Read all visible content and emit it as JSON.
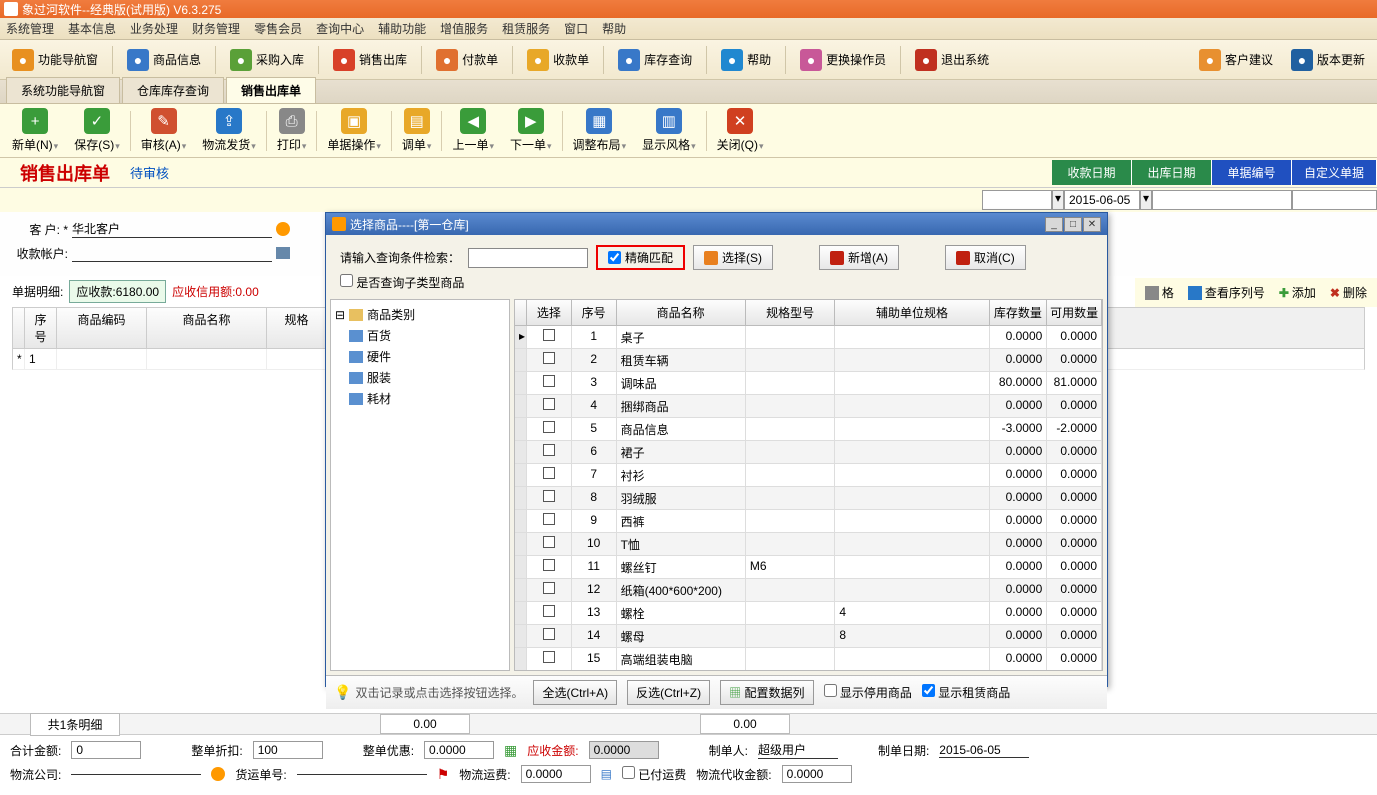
{
  "titlebar": "象过河软件--经典版(试用版)  V6.3.275",
  "menus": [
    "系统管理",
    "基本信息",
    "业务处理",
    "财务管理",
    "零售会员",
    "查询中心",
    "辅助功能",
    "增值服务",
    "租赁服务",
    "窗口",
    "帮助"
  ],
  "toolbar": [
    {
      "label": "功能导航窗",
      "color": "#e89020"
    },
    {
      "label": "商品信息",
      "color": "#3878c8"
    },
    {
      "label": "采购入库",
      "color": "#5aa038"
    },
    {
      "label": "销售出库",
      "color": "#d84028"
    },
    {
      "label": "付款单",
      "color": "#e07030"
    },
    {
      "label": "收款单",
      "color": "#e8a828"
    },
    {
      "label": "库存查询",
      "color": "#3878c8"
    },
    {
      "label": "帮助",
      "color": "#2088d0"
    },
    {
      "label": "更换操作员",
      "color": "#c85898"
    },
    {
      "label": "退出系统",
      "color": "#c03020"
    }
  ],
  "toolbar_right": [
    {
      "label": "客户建议",
      "color": "#e89030"
    },
    {
      "label": "版本更新",
      "color": "#2060a0"
    }
  ],
  "tabs": [
    "系统功能导航窗",
    "仓库库存查询",
    "销售出库单"
  ],
  "active_tab": 2,
  "doc_buttons": [
    {
      "label": "新单(N)",
      "color": "#3a9c3a",
      "glyph": "+"
    },
    {
      "label": "保存(S)",
      "color": "#3a9c3a",
      "glyph": "✓"
    },
    {
      "label": "审核(A)",
      "color": "#d05030",
      "glyph": "✎"
    },
    {
      "label": "物流发货",
      "color": "#2878c8",
      "glyph": "⇪"
    },
    {
      "label": "打印",
      "color": "#888",
      "glyph": "⎙"
    },
    {
      "label": "单据操作",
      "color": "#e8a828",
      "glyph": "▣"
    },
    {
      "label": "调单",
      "color": "#e8a828",
      "glyph": "▤"
    },
    {
      "label": "上一单",
      "color": "#3a9c3a",
      "glyph": "◀"
    },
    {
      "label": "下一单",
      "color": "#3a9c3a",
      "glyph": "▶"
    },
    {
      "label": "调整布局",
      "color": "#3878c8",
      "glyph": "▦"
    },
    {
      "label": "显示风格",
      "color": "#3878c8",
      "glyph": "▥"
    },
    {
      "label": "关闭(Q)",
      "color": "#d04020",
      "glyph": "✕"
    }
  ],
  "header": {
    "title": "销售出库单",
    "status": "待审核"
  },
  "header_buttons": [
    {
      "label": "收款日期",
      "bg": "#2a8a4a"
    },
    {
      "label": "出库日期",
      "bg": "#2a8a4a"
    },
    {
      "label": "单据编号",
      "bg": "#2050c0"
    },
    {
      "label": "自定义单据",
      "bg": "#2050c0"
    }
  ],
  "header_values": {
    "date": "2015-06-05"
  },
  "form": {
    "customer_label": "客    户: *",
    "customer": "华北客户",
    "account_label": "收款帐户:",
    "detail_label": "单据明细:",
    "receivable_label": "应收款:",
    "receivable": "6180.00",
    "credit_label": "应收信用额:",
    "credit": "0.00"
  },
  "grid_cols": [
    "序号",
    "商品编码",
    "商品名称",
    "规格"
  ],
  "grid_first": "1",
  "right_tools": [
    {
      "label": "格",
      "color": "#888"
    },
    {
      "label": "查看序列号",
      "color": "#2878c8"
    },
    {
      "label": "添加",
      "color": "#3a9c3a",
      "glyph": "✚"
    },
    {
      "label": "删除",
      "color": "#c03020",
      "glyph": "✖"
    }
  ],
  "modal": {
    "title": "选择商品----[第一仓库]",
    "search_label": "请输入查询条件检索：",
    "exact_label": "精确匹配",
    "sub_check": "是否查询子类型商品",
    "btn_select": "选择(S)",
    "btn_add": "新增(A)",
    "btn_cancel": "取消(C)",
    "tree_root": "商品类别",
    "tree_items": [
      "百货",
      "硬件",
      "服装",
      "耗材"
    ],
    "cols": [
      "选择",
      "序号",
      "商品名称",
      "规格型号",
      "辅助单位规格",
      "库存数量",
      "可用数量"
    ],
    "rows": [
      {
        "i": 1,
        "name": "桌子",
        "spec": "",
        "aux": "",
        "stock": "0.0000",
        "avail": "0.0000"
      },
      {
        "i": 2,
        "name": "租赁车辆",
        "spec": "",
        "aux": "",
        "stock": "0.0000",
        "avail": "0.0000"
      },
      {
        "i": 3,
        "name": "调味品",
        "spec": "",
        "aux": "",
        "stock": "80.0000",
        "avail": "81.0000"
      },
      {
        "i": 4,
        "name": "捆绑商品",
        "spec": "",
        "aux": "",
        "stock": "0.0000",
        "avail": "0.0000"
      },
      {
        "i": 5,
        "name": "商品信息",
        "spec": "",
        "aux": "",
        "stock": "-3.0000",
        "avail": "-2.0000"
      },
      {
        "i": 6,
        "name": "裙子",
        "spec": "",
        "aux": "",
        "stock": "0.0000",
        "avail": "0.0000"
      },
      {
        "i": 7,
        "name": "衬衫",
        "spec": "",
        "aux": "",
        "stock": "0.0000",
        "avail": "0.0000"
      },
      {
        "i": 8,
        "name": "羽绒服",
        "spec": "",
        "aux": "",
        "stock": "0.0000",
        "avail": "0.0000"
      },
      {
        "i": 9,
        "name": "西裤",
        "spec": "",
        "aux": "",
        "stock": "0.0000",
        "avail": "0.0000"
      },
      {
        "i": 10,
        "name": "T恤",
        "spec": "",
        "aux": "",
        "stock": "0.0000",
        "avail": "0.0000"
      },
      {
        "i": 11,
        "name": "螺丝钉",
        "spec": "M6",
        "aux": "",
        "stock": "0.0000",
        "avail": "0.0000"
      },
      {
        "i": 12,
        "name": "纸箱(400*600*200)",
        "spec": "",
        "aux": "",
        "stock": "0.0000",
        "avail": "0.0000"
      },
      {
        "i": 13,
        "name": "螺栓",
        "spec": "",
        "aux": "4",
        "stock": "0.0000",
        "avail": "0.0000"
      },
      {
        "i": 14,
        "name": "螺母",
        "spec": "",
        "aux": "8",
        "stock": "0.0000",
        "avail": "0.0000"
      },
      {
        "i": 15,
        "name": "高端组装电脑",
        "spec": "",
        "aux": "",
        "stock": "0.0000",
        "avail": "0.0000"
      }
    ],
    "hint": "双击记录或点击选择按钮选择。",
    "btn_all": "全选(Ctrl+A)",
    "btn_inv": "反选(Ctrl+Z)",
    "btn_cfg": "配置数据列",
    "chk_disabled": "显示停用商品",
    "chk_rental": "显示租赁商品"
  },
  "bottom": {
    "count": "共1条明细",
    "v1": "0.00",
    "v2": "0.00"
  },
  "summary": {
    "total_label": "合计金额:",
    "total": "0",
    "discount_label": "整单折扣:",
    "discount": "100",
    "pref_label": "整单优惠:",
    "pref": "0.0000",
    "recv_label": "应收金额:",
    "recv": "0.0000",
    "maker_label": "制单人:",
    "maker": "超级用户",
    "date_label": "制单日期:",
    "date": "2015-06-05",
    "logistics_label": "物流公司:",
    "shipno_label": "货运单号:",
    "freight_label": "物流运费:",
    "freight": "0.0000",
    "paid_label": "已付运费",
    "cod_label": "物流代收金额:",
    "cod": "0.0000"
  }
}
